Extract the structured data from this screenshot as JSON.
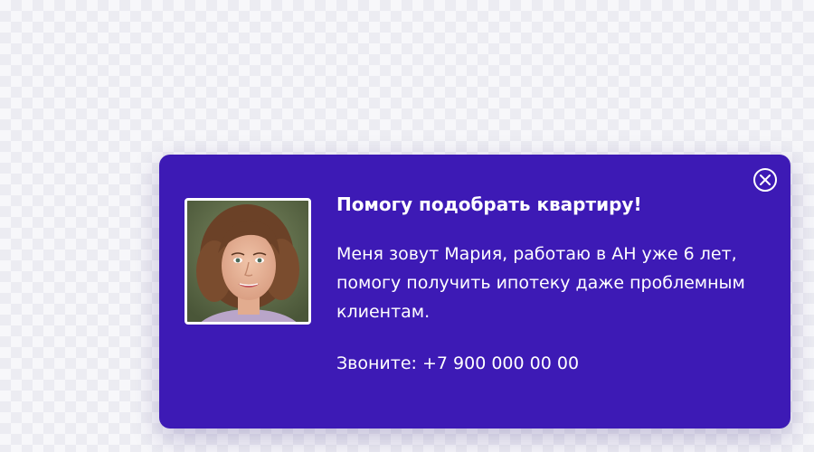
{
  "popup": {
    "title": "Помогу подобрать квартиру!",
    "description": "Меня зовут Мария, работаю в АН уже 6 лет, помогу получить ипотеку даже проблемным клиентам.",
    "call_label": "Звоните:",
    "phone": "+7 900 000 00 00",
    "close_icon": "close-circle-icon",
    "avatar_icon": "agent-photo"
  },
  "colors": {
    "popup_background": "#3d1ab5",
    "text": "#ffffff",
    "page_background": "#f7f7fa"
  }
}
